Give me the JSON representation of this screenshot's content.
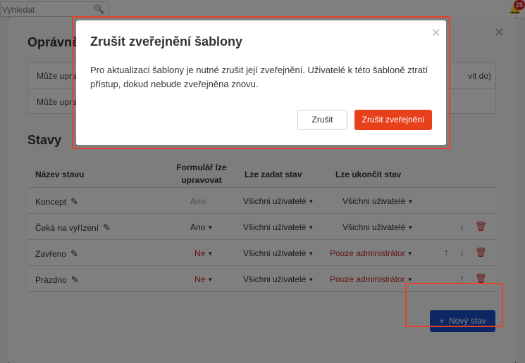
{
  "topbar": {
    "search_placeholder": "Vyhledat",
    "notification_count": "25"
  },
  "main_modal": {
    "permissions_title": "Oprávně",
    "permissions": [
      {
        "label": "Může upra",
        "right": "vit do)"
      },
      {
        "label": "Může upra",
        "right": ""
      }
    ],
    "states_title": "Stavy",
    "headers": {
      "name": "Název stavu",
      "editable": "Formulář lze upravovat",
      "can_set": "Lze zadat stav",
      "can_end": "Lze ukončit stav"
    },
    "rows": [
      {
        "name": "Koncept",
        "editable": "Ano",
        "can_set": "Všichni uživatelé",
        "can_end": "Všichni uživatelé"
      },
      {
        "name": "Čeká na vyřízení",
        "editable": "Ano",
        "can_set": "Všichni uživatelé",
        "can_end": "Všichni uživatelé"
      },
      {
        "name": "Zavřeno",
        "editable": "Ne",
        "can_set": "Všichni uživatelé",
        "can_end": "Pouze administrátor"
      },
      {
        "name": "Prázdno",
        "editable": "Ne",
        "can_set": "Všichni uživatelé",
        "can_end": "Pouze administrátor"
      }
    ],
    "new_state_label": "Nový stav"
  },
  "confirm": {
    "title": "Zrušit zveřejnění šablony",
    "message": "Pro aktualizaci šablony je nutné zrušit její zveřejnění. Uživatelé k této šabloně ztratí přístup, dokud nebude zveřejněna znovu.",
    "cancel_label": "Zrušit",
    "confirm_label": "Zrušit zveřejnění"
  },
  "colors": {
    "primary_button": "#1a4fc9",
    "danger_button": "#e8401c",
    "highlight": "#e8402a"
  }
}
